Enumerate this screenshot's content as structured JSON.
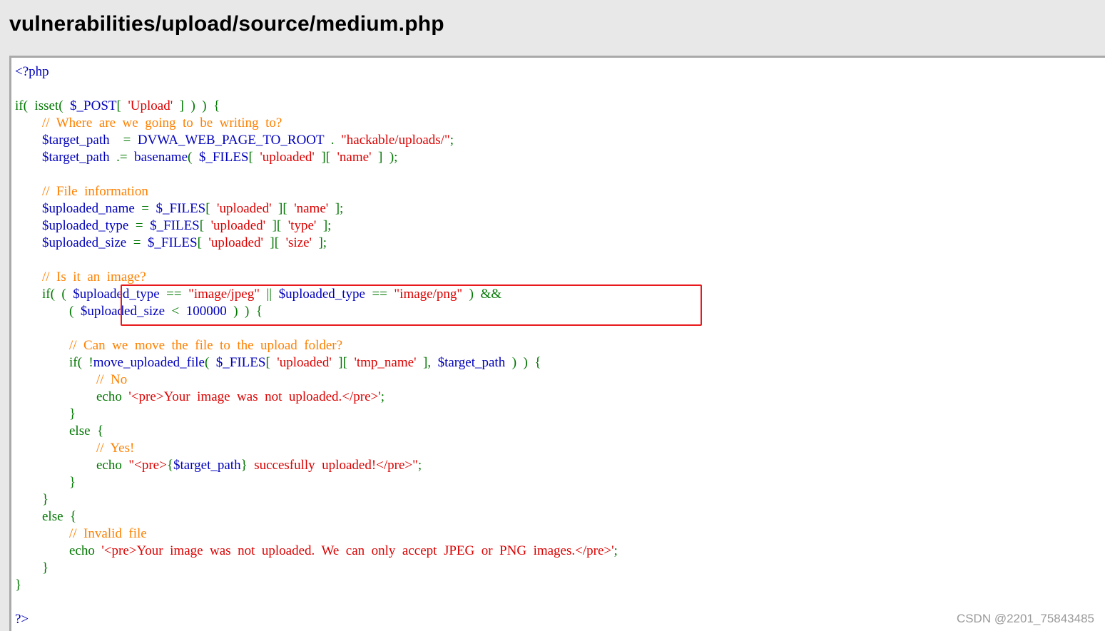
{
  "title": "vulnerabilities/upload/source/medium.php",
  "watermark": "CSDN @2201_75843485",
  "highlight": {
    "color": "#e8191c",
    "note": "lines 14-15 (MIME type and size check) outlined"
  },
  "colors": {
    "keyword": "#007700",
    "string": "#dd0000",
    "comment": "#ff8000",
    "variable": "#0000bb",
    "default": "#000000"
  },
  "code_lines": [
    [
      [
        "v",
        "<?php"
      ]
    ],
    [],
    [
      [
        "k",
        "if(  isset(  "
      ],
      [
        "v",
        "$_POST"
      ],
      [
        "k",
        "[  "
      ],
      [
        "s",
        "'Upload'"
      ],
      [
        "k",
        "  ]  )  )  {"
      ]
    ],
    [
      [
        "k",
        "        "
      ],
      [
        "c",
        "//  Where  are  we  going  to  be  writing  to?"
      ]
    ],
    [
      [
        "k",
        "        "
      ],
      [
        "v",
        "$target_path    "
      ],
      [
        "k",
        "=  "
      ],
      [
        "v",
        "DVWA_WEB_PAGE_TO_ROOT  "
      ],
      [
        "k",
        ".  "
      ],
      [
        "s",
        "\"hackable/uploads/\""
      ],
      [
        "k",
        ";"
      ]
    ],
    [
      [
        "k",
        "        "
      ],
      [
        "v",
        "$target_path  "
      ],
      [
        "k",
        ".=  "
      ],
      [
        "v",
        "basename"
      ],
      [
        "k",
        "(  "
      ],
      [
        "v",
        "$_FILES"
      ],
      [
        "k",
        "[  "
      ],
      [
        "s",
        "'uploaded'"
      ],
      [
        "k",
        "  ][  "
      ],
      [
        "s",
        "'name'"
      ],
      [
        "k",
        "  ]  );"
      ]
    ],
    [],
    [
      [
        "k",
        "        "
      ],
      [
        "c",
        "//  File  information"
      ]
    ],
    [
      [
        "k",
        "        "
      ],
      [
        "v",
        "$uploaded_name  "
      ],
      [
        "k",
        "=  "
      ],
      [
        "v",
        "$_FILES"
      ],
      [
        "k",
        "[  "
      ],
      [
        "s",
        "'uploaded'"
      ],
      [
        "k",
        "  ][  "
      ],
      [
        "s",
        "'name'"
      ],
      [
        "k",
        "  ];"
      ]
    ],
    [
      [
        "k",
        "        "
      ],
      [
        "v",
        "$uploaded_type  "
      ],
      [
        "k",
        "=  "
      ],
      [
        "v",
        "$_FILES"
      ],
      [
        "k",
        "[  "
      ],
      [
        "s",
        "'uploaded'"
      ],
      [
        "k",
        "  ][  "
      ],
      [
        "s",
        "'type'"
      ],
      [
        "k",
        "  ];"
      ]
    ],
    [
      [
        "k",
        "        "
      ],
      [
        "v",
        "$uploaded_size  "
      ],
      [
        "k",
        "=  "
      ],
      [
        "v",
        "$_FILES"
      ],
      [
        "k",
        "[  "
      ],
      [
        "s",
        "'uploaded'"
      ],
      [
        "k",
        "  ][  "
      ],
      [
        "s",
        "'size'"
      ],
      [
        "k",
        "  ];"
      ]
    ],
    [],
    [
      [
        "k",
        "        "
      ],
      [
        "c",
        "//  Is  it  an  image?"
      ]
    ],
    [
      [
        "k",
        "        if(  (  "
      ],
      [
        "v",
        "$uploaded_type  "
      ],
      [
        "k",
        "==  "
      ],
      [
        "s",
        "\"image/jpeg\"  "
      ],
      [
        "k",
        "||  "
      ],
      [
        "v",
        "$uploaded_type  "
      ],
      [
        "k",
        "==  "
      ],
      [
        "s",
        "\"image/png\"  "
      ],
      [
        "k",
        ")  &&"
      ]
    ],
    [
      [
        "k",
        "                (  "
      ],
      [
        "v",
        "$uploaded_size  "
      ],
      [
        "k",
        "<  "
      ],
      [
        "v",
        "100000  "
      ],
      [
        "k",
        ")  )  {"
      ]
    ],
    [],
    [
      [
        "k",
        "                "
      ],
      [
        "c",
        "//  Can  we  move  the  file  to  the  upload  folder?"
      ]
    ],
    [
      [
        "k",
        "                if(  !"
      ],
      [
        "v",
        "move_uploaded_file"
      ],
      [
        "k",
        "(  "
      ],
      [
        "v",
        "$_FILES"
      ],
      [
        "k",
        "[  "
      ],
      [
        "s",
        "'uploaded'"
      ],
      [
        "k",
        "  ][  "
      ],
      [
        "s",
        "'tmp_name'"
      ],
      [
        "k",
        "  ],  "
      ],
      [
        "v",
        "$target_path  "
      ],
      [
        "k",
        ")  )  {"
      ]
    ],
    [
      [
        "k",
        "                        "
      ],
      [
        "c",
        "//  No"
      ]
    ],
    [
      [
        "k",
        "                        echo  "
      ],
      [
        "s",
        "'<pre>Your  image  was  not  uploaded.</pre>'"
      ],
      [
        "k",
        ";"
      ]
    ],
    [
      [
        "k",
        "                }"
      ]
    ],
    [
      [
        "k",
        "                else  {"
      ]
    ],
    [
      [
        "k",
        "                        "
      ],
      [
        "c",
        "//  Yes!"
      ]
    ],
    [
      [
        "k",
        "                        echo  "
      ],
      [
        "s",
        "\"<pre>"
      ],
      [
        "k",
        "{"
      ],
      [
        "v",
        "$target_path"
      ],
      [
        "k",
        "}  "
      ],
      [
        "s",
        "succesfully  uploaded!</pre>\""
      ],
      [
        "k",
        ";"
      ]
    ],
    [
      [
        "k",
        "                }"
      ]
    ],
    [
      [
        "k",
        "        }"
      ]
    ],
    [
      [
        "k",
        "        else  {"
      ]
    ],
    [
      [
        "k",
        "                "
      ],
      [
        "c",
        "//  Invalid  file"
      ]
    ],
    [
      [
        "k",
        "                echo  "
      ],
      [
        "s",
        "'<pre>Your  image  was  not  uploaded.  We  can  only  accept  JPEG  or  PNG  images.</pre>'"
      ],
      [
        "k",
        ";"
      ]
    ],
    [
      [
        "k",
        "        }"
      ]
    ],
    [
      [
        "k",
        "}"
      ]
    ],
    [],
    [
      [
        "v",
        "?>"
      ]
    ]
  ]
}
